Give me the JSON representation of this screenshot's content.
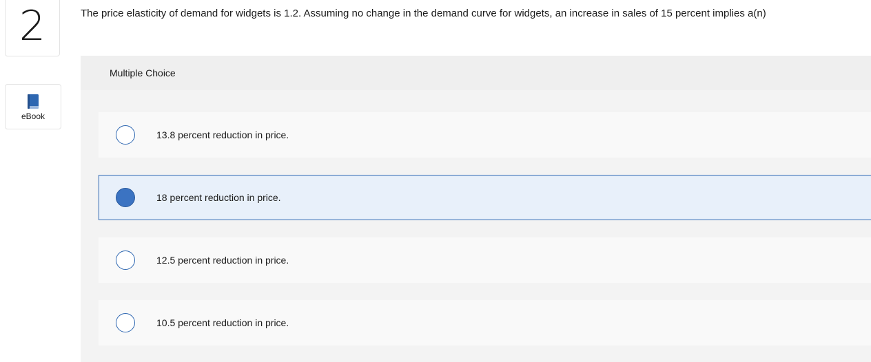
{
  "question_number": "2",
  "sidebar": {
    "ebook_label": "eBook",
    "ebook_icon": "book-icon"
  },
  "question_text": "The price elasticity of demand for widgets is 1.2. Assuming no change in the demand curve for widgets, an increase in sales of 15 percent implies a(n)",
  "answer_panel": {
    "type_label": "Multiple Choice",
    "options": [
      {
        "label": "13.8 percent reduction in price.",
        "selected": false
      },
      {
        "label": "18 percent reduction in price.",
        "selected": true
      },
      {
        "label": "12.5 percent reduction in price.",
        "selected": false
      },
      {
        "label": "10.5 percent reduction in price.",
        "selected": false
      }
    ]
  },
  "colors": {
    "accent": "#2e67b1",
    "selected_background": "#e8f0fa",
    "panel_background": "#f3f3f3"
  }
}
